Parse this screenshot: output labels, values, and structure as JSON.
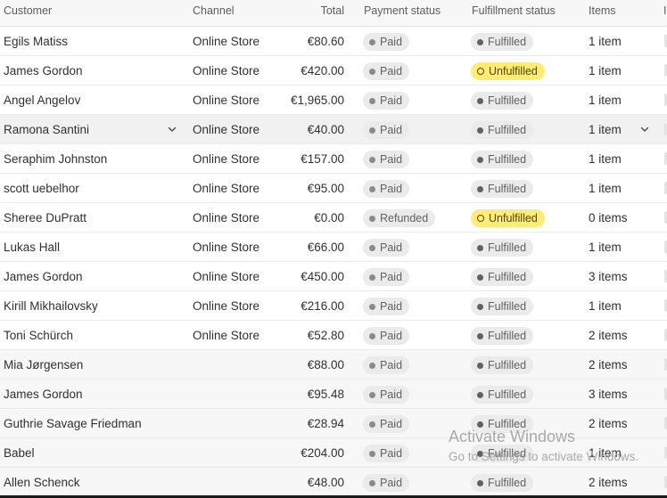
{
  "headers": {
    "customer": "Customer",
    "channel": "Channel",
    "total": "Total",
    "payment_status": "Payment status",
    "fulfillment_status": "Fulfillment status",
    "items": "Items",
    "next_col_partial": "I"
  },
  "rows": [
    {
      "customer": "Egils Matiss",
      "channel": "Online Store",
      "total": "€80.60",
      "payment": "Paid",
      "fulfillment": "Fulfilled",
      "items": "1 item"
    },
    {
      "customer": "James Gordon",
      "channel": "Online Store",
      "total": "€420.00",
      "payment": "Paid",
      "fulfillment": "Unfulfilled",
      "items": "1 item"
    },
    {
      "customer": "Angel Angelov",
      "channel": "Online Store",
      "total": "€1,965.00",
      "payment": "Paid",
      "fulfillment": "Fulfilled",
      "items": "1 item"
    },
    {
      "customer": "Ramona Santini",
      "channel": "Online Store",
      "total": "€40.00",
      "payment": "Paid",
      "fulfillment": "Fulfilled",
      "items": "1 item"
    },
    {
      "customer": "Seraphim Johnston",
      "channel": "Online Store",
      "total": "€157.00",
      "payment": "Paid",
      "fulfillment": "Fulfilled",
      "items": "1 item"
    },
    {
      "customer": "scott uebelhor",
      "channel": "Online Store",
      "total": "€95.00",
      "payment": "Paid",
      "fulfillment": "Fulfilled",
      "items": "1 item"
    },
    {
      "customer": "Sheree DuPratt",
      "channel": "Online Store",
      "total": "€0.00",
      "payment": "Refunded",
      "fulfillment": "Unfulfilled",
      "items": "0 items"
    },
    {
      "customer": "Lukas Hall",
      "channel": "Online Store",
      "total": "€66.00",
      "payment": "Paid",
      "fulfillment": "Fulfilled",
      "items": "1 item"
    },
    {
      "customer": "James Gordon",
      "channel": "Online Store",
      "total": "€450.00",
      "payment": "Paid",
      "fulfillment": "Fulfilled",
      "items": "3 items"
    },
    {
      "customer": "Kirill Mikhailovsky",
      "channel": "Online Store",
      "total": "€216.00",
      "payment": "Paid",
      "fulfillment": "Fulfilled",
      "items": "1 item"
    },
    {
      "customer": "Toni Schürch",
      "channel": "Online Store",
      "total": "€52.80",
      "payment": "Paid",
      "fulfillment": "Fulfilled",
      "items": "2 items"
    },
    {
      "customer": "Mia Jørgensen",
      "channel": "",
      "total": "€88.00",
      "payment": "Paid",
      "fulfillment": "Fulfilled",
      "items": "2 items"
    },
    {
      "customer": "James Gordon",
      "channel": "",
      "total": "€95.48",
      "payment": "Paid",
      "fulfillment": "Fulfilled",
      "items": "3 items"
    },
    {
      "customer": "Guthrie Savage Friedman",
      "channel": "",
      "total": "€28.94",
      "payment": "Paid",
      "fulfillment": "Fulfilled",
      "items": "2 items"
    },
    {
      "customer": "Babel",
      "channel": "",
      "total": "€204.00",
      "payment": "Paid",
      "fulfillment": "Fulfilled",
      "items": "1 item"
    },
    {
      "customer": "Allen Schenck",
      "channel": "",
      "total": "€48.00",
      "payment": "Paid",
      "fulfillment": "Fulfilled",
      "items": "2 items"
    }
  ],
  "watermark": {
    "title": "Activate Windows",
    "subtitle": "Go to Settings to activate Windows."
  },
  "colors": {
    "header_bg": "#f7f7f7",
    "neutral_badge": "#ebebeb",
    "unfulfilled_badge": "#ffeb78",
    "hover_row": "#f1f1f1"
  },
  "icons": {
    "row_expand": "chevron-down-icon",
    "status_dot": "filled-dot",
    "unfulfilled_ring": "hollow-ring"
  }
}
